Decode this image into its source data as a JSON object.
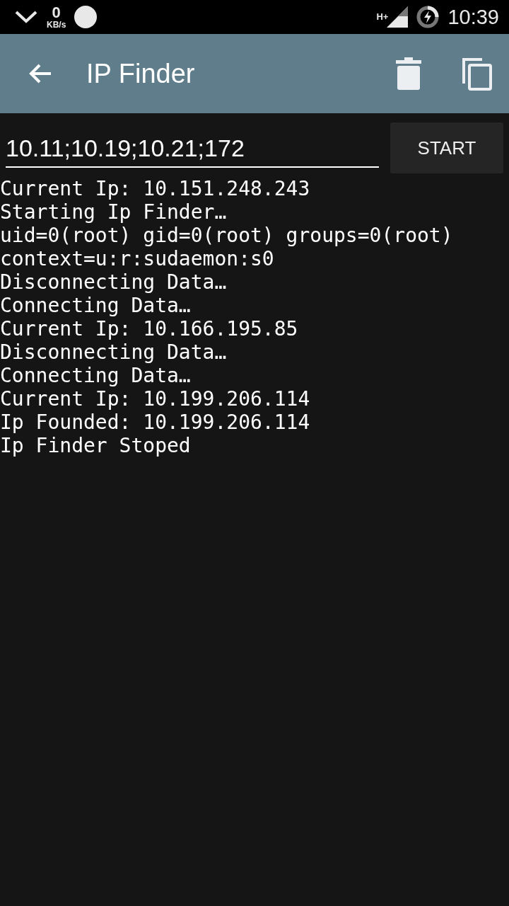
{
  "status_bar": {
    "speed_value": "0",
    "speed_unit": "KB/s",
    "network": "H+",
    "time": "10:39"
  },
  "app_bar": {
    "title": "IP Finder"
  },
  "input": {
    "value": "10.11;10.19;10.21;172"
  },
  "start_button": "START",
  "log": [
    "Current Ip: 10.151.248.243",
    "Starting Ip Finder…",
    "uid=0(root) gid=0(root) groups=0(root)",
    "context=u:r:sudaemon:s0",
    "Disconnecting Data…",
    "Connecting Data…",
    "Current Ip: 10.166.195.85",
    "Disconnecting Data…",
    "Connecting Data…",
    "Current Ip: 10.199.206.114",
    "Ip Founded: 10.199.206.114",
    "Ip Finder Stoped"
  ]
}
